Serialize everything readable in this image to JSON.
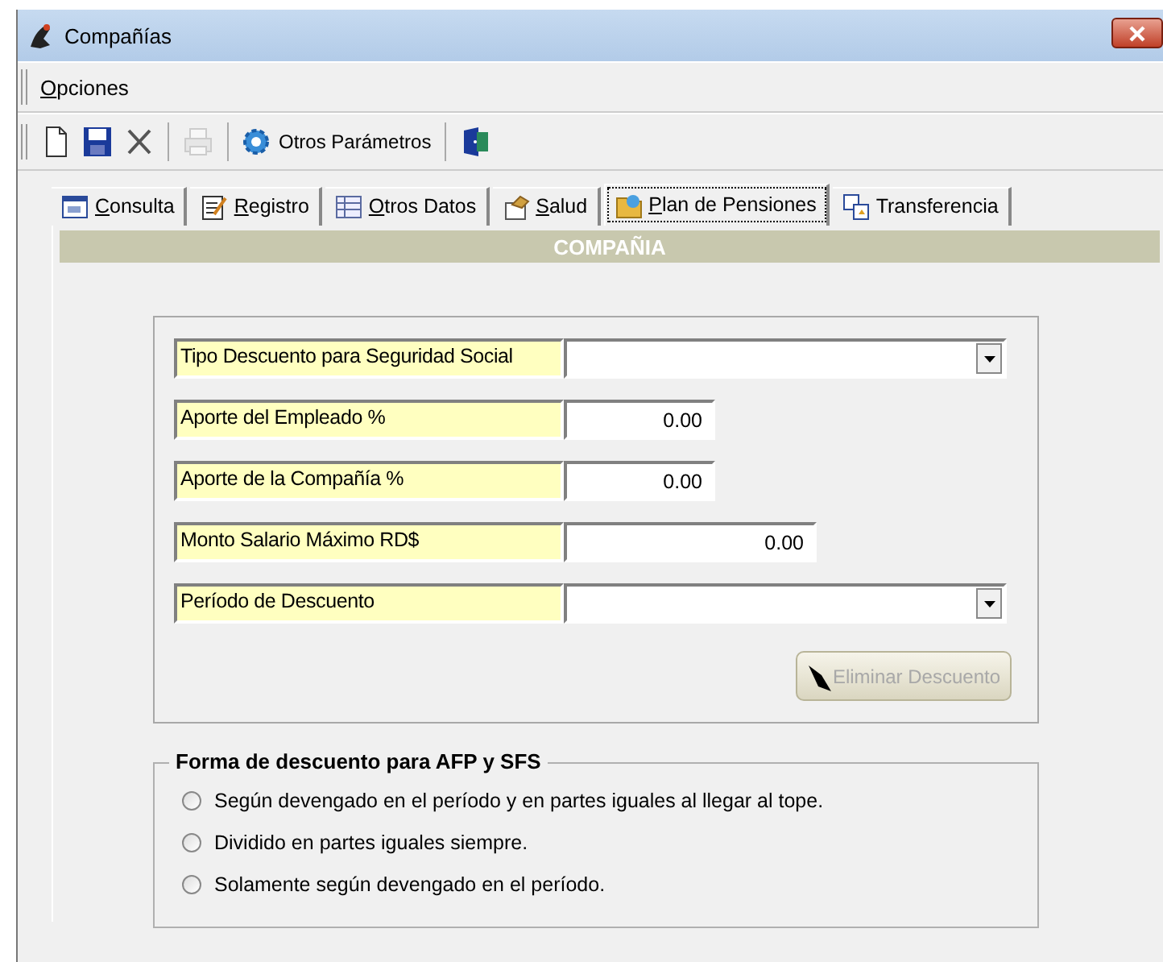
{
  "window": {
    "title": "Compañías"
  },
  "menu": [
    {
      "label": "Opciones",
      "mnemonic": true
    }
  ],
  "toolbar": [
    {
      "kind": "new",
      "disabled": false
    },
    {
      "kind": "save",
      "disabled": false
    },
    {
      "kind": "delete",
      "disabled": false
    },
    {
      "kind": "separator"
    },
    {
      "kind": "print",
      "disabled": true
    },
    {
      "kind": "separator"
    },
    {
      "kind": "gear",
      "label": "Otros Parámetros",
      "disabled": false
    },
    {
      "kind": "separator"
    },
    {
      "kind": "exit",
      "disabled": false
    }
  ],
  "tabs": [
    {
      "label": "Consulta",
      "selected": false,
      "mnemonic": true
    },
    {
      "label": "Registro",
      "selected": false,
      "mnemonic": true
    },
    {
      "label": "Otros Datos",
      "selected": false,
      "mnemonic": true
    },
    {
      "label": "Salud",
      "selected": false,
      "mnemonic": true
    },
    {
      "label": "Plan de Pensiones",
      "selected": true,
      "mnemonic": true
    },
    {
      "label": "Transferencia",
      "selected": false,
      "mnemonic": false
    }
  ],
  "section_header": "COMPAÑIA",
  "fields": [
    {
      "label": "Tipo Descuento para Seguridad Social",
      "kind": "dropdown"
    },
    {
      "label": "Aporte del Empleado %",
      "kind": "percent",
      "value": "0.00"
    },
    {
      "label": "Aporte de la Compañía %",
      "kind": "percent",
      "value": "0.00"
    },
    {
      "label": "Monto Salario Máximo RD$",
      "kind": "amount",
      "value": "0.00"
    },
    {
      "label": "Período de Descuento",
      "kind": "dropdown"
    }
  ],
  "delete_button": {
    "label": "Eliminar Descuento",
    "disabled": true
  },
  "discount_group": {
    "title": "Forma de descuento para AFP y SFS",
    "options": [
      {
        "label": "Según devengado en el período y en partes iguales al llegar al tope.",
        "selected": false
      },
      {
        "label": "Dividido en partes iguales siempre.",
        "selected": false
      },
      {
        "label": "Solamente según devengado en el período.",
        "selected": false
      }
    ]
  }
}
